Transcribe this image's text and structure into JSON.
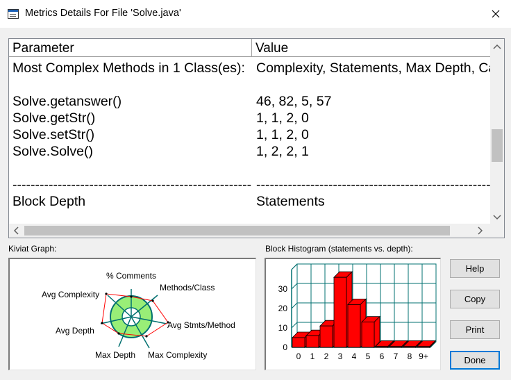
{
  "window": {
    "title": "Metrics Details For File 'Solve.java'"
  },
  "grid": {
    "columns": [
      "Parameter",
      "Value"
    ],
    "rows": [
      {
        "param": "Most Complex Methods in 1 Class(es):",
        "value": "Complexity, Statements, Max Depth, Calls"
      },
      {
        "param": "",
        "value": ""
      },
      {
        "param": "Solve.getanswer()",
        "value": "46, 82, 5, 57"
      },
      {
        "param": "Solve.getStr()",
        "value": "1, 1, 2, 0"
      },
      {
        "param": "Solve.setStr()",
        "value": "1, 1, 2, 0"
      },
      {
        "param": "Solve.Solve()",
        "value": "1, 2, 2, 1"
      },
      {
        "param": "",
        "value": ""
      },
      {
        "param": "-----------------------------------------------------",
        "value": "-----------------------------------------------------"
      },
      {
        "param": "Block Depth",
        "value": "Statements"
      }
    ]
  },
  "kiviat": {
    "label": "Kiviat Graph:",
    "axes": [
      "% Comments",
      "Methods/Class",
      "Avg Stmts/Method",
      "Max Complexity",
      "Max Depth",
      "Avg Depth",
      "Avg Complexity"
    ]
  },
  "histogram": {
    "label": "Block Histogram (statements vs. depth):"
  },
  "chart_data": {
    "type": "bar",
    "categories": [
      "0",
      "1",
      "2",
      "3",
      "4",
      "5",
      "6",
      "7",
      "8",
      "9+"
    ],
    "values": [
      5,
      6,
      11,
      36,
      22,
      13,
      0,
      0,
      0,
      0
    ],
    "title": "Block Histogram (statements vs. depth):",
    "xlabel": "",
    "ylabel": "",
    "ylim": [
      0,
      40
    ],
    "yticks": [
      "0",
      "10",
      "20",
      "30"
    ],
    "colors": {
      "bar": "#ff0000",
      "grid": "#007070"
    }
  },
  "buttons": {
    "help": "Help",
    "copy": "Copy",
    "print": "Print",
    "done": "Done"
  },
  "icons": {
    "app": "app-window-icon",
    "close": "close-icon",
    "up": "scroll-up-icon",
    "down": "scroll-down-icon",
    "left": "scroll-left-icon",
    "right": "scroll-right-icon"
  }
}
